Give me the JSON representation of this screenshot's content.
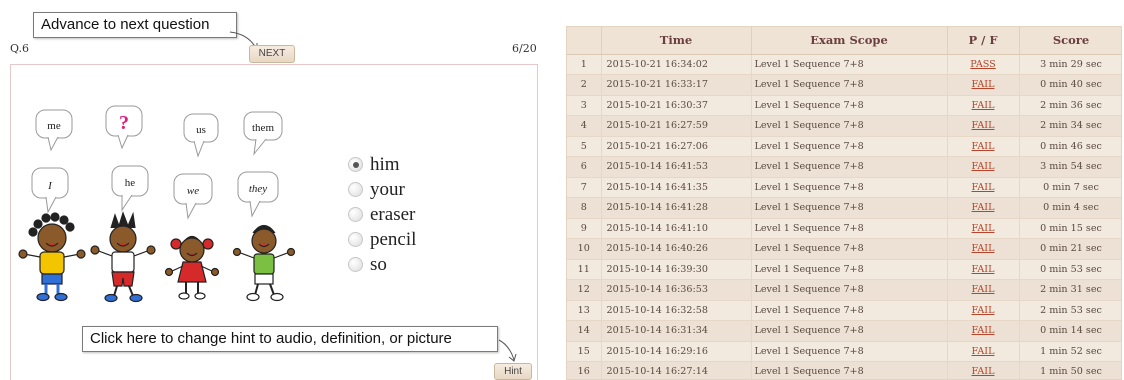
{
  "callouts": {
    "next": "Advance to next question",
    "hint": "Click here to change hint to audio, definition, or picture"
  },
  "quiz": {
    "question_number": "Q.6",
    "progress": "6/20",
    "next_label": "NEXT",
    "hint_label": "Hint",
    "bubbles_top": [
      "me",
      "?",
      "us",
      "them"
    ],
    "bubbles_bottom": [
      "I",
      "he",
      "we",
      "they"
    ],
    "options": [
      {
        "label": "him",
        "selected": true
      },
      {
        "label": "your",
        "selected": false
      },
      {
        "label": "eraser",
        "selected": false
      },
      {
        "label": "pencil",
        "selected": false
      },
      {
        "label": "so",
        "selected": false
      }
    ]
  },
  "history": {
    "columns": [
      "",
      "Time",
      "Exam Scope",
      "P / F",
      "Score"
    ],
    "rows": [
      [
        "1",
        "2015-10-21 16:34:02",
        "Level 1 Sequence 7+8",
        "PASS",
        "3 min 29 sec"
      ],
      [
        "2",
        "2015-10-21 16:33:17",
        "Level 1 Sequence 7+8",
        "FAIL",
        "0 min 40 sec"
      ],
      [
        "3",
        "2015-10-21 16:30:37",
        "Level 1 Sequence 7+8",
        "FAIL",
        "2 min 36 sec"
      ],
      [
        "4",
        "2015-10-21 16:27:59",
        "Level 1 Sequence 7+8",
        "FAIL",
        "2 min 34 sec"
      ],
      [
        "5",
        "2015-10-21 16:27:06",
        "Level 1 Sequence 7+8",
        "FAIL",
        "0 min 46 sec"
      ],
      [
        "6",
        "2015-10-14 16:41:53",
        "Level 1 Sequence 7+8",
        "FAIL",
        "3 min 54 sec"
      ],
      [
        "7",
        "2015-10-14 16:41:35",
        "Level 1 Sequence 7+8",
        "FAIL",
        "0 min 7 sec"
      ],
      [
        "8",
        "2015-10-14 16:41:28",
        "Level 1 Sequence 7+8",
        "FAIL",
        "0 min 4 sec"
      ],
      [
        "9",
        "2015-10-14 16:41:10",
        "Level 1 Sequence 7+8",
        "FAIL",
        "0 min 15 sec"
      ],
      [
        "10",
        "2015-10-14 16:40:26",
        "Level 1 Sequence 7+8",
        "FAIL",
        "0 min 21 sec"
      ],
      [
        "11",
        "2015-10-14 16:39:30",
        "Level 1 Sequence 7+8",
        "FAIL",
        "0 min 53 sec"
      ],
      [
        "12",
        "2015-10-14 16:36:53",
        "Level 1 Sequence 7+8",
        "FAIL",
        "2 min 31 sec"
      ],
      [
        "13",
        "2015-10-14 16:32:58",
        "Level 1 Sequence 7+8",
        "FAIL",
        "2 min 53 sec"
      ],
      [
        "14",
        "2015-10-14 16:31:34",
        "Level 1 Sequence 7+8",
        "FAIL",
        "0 min 14 sec"
      ],
      [
        "15",
        "2015-10-14 16:29:16",
        "Level 1 Sequence 7+8",
        "FAIL",
        "1 min 52 sec"
      ],
      [
        "16",
        "2015-10-14 16:27:14",
        "Level 1 Sequence 7+8",
        "FAIL",
        "1 min 50 sec"
      ]
    ]
  }
}
